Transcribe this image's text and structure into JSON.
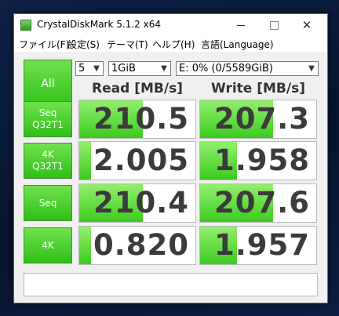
{
  "window": {
    "title": "CrystalDiskMark 5.1.2 x64"
  },
  "titlebar": {
    "minimize_icon": "minimize-icon",
    "maximize_icon": "maximize-icon",
    "close_icon": "close-icon",
    "close_glyph": "✕"
  },
  "menu": [
    "ファイル(F)",
    "設定(S)",
    "テーマ(T)",
    "ヘルプ(H)",
    "言語(Language)"
  ],
  "controls": {
    "all_label": "All",
    "count": "5",
    "size": "1GiB",
    "drive": "E: 0% (0/5589GiB)",
    "dropdown_icon": "chevron-down-icon"
  },
  "headers": {
    "read": "Read [MB/s]",
    "write": "Write [MB/s]"
  },
  "rows": [
    {
      "line1": "Seq",
      "line2": "Q32T1",
      "read": "210.5",
      "write": "207.3",
      "read_fill": 0.55,
      "write_fill": 0.63
    },
    {
      "line1": "4K",
      "line2": "Q32T1",
      "read": "2.005",
      "write": "1.958",
      "read_fill": 0.1,
      "write_fill": 0.32
    },
    {
      "line1": "Seq",
      "line2": "",
      "read": "210.4",
      "write": "207.6",
      "read_fill": 0.55,
      "write_fill": 0.63
    },
    {
      "line1": "4K",
      "line2": "",
      "read": "0.820",
      "write": "1.957",
      "read_fill": 0.1,
      "write_fill": 0.32
    }
  ],
  "colors": {
    "accent_green": "#2fbf17",
    "value_text": "#3b3b3b"
  },
  "comment": ""
}
